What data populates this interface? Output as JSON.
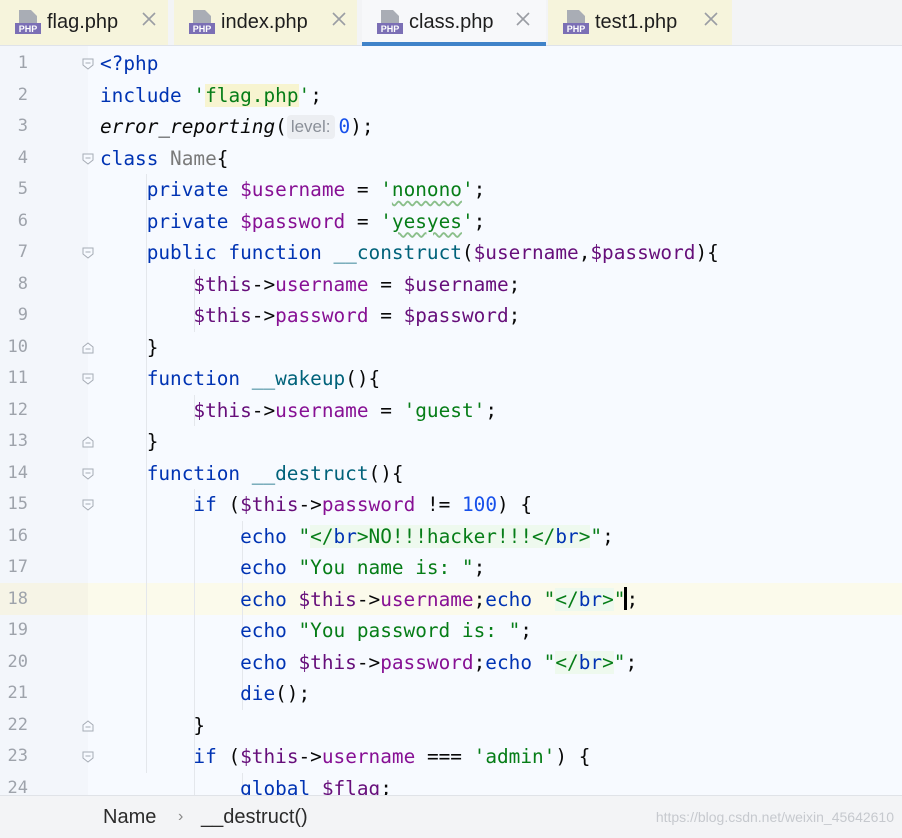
{
  "tabs": [
    {
      "label": "flag.php",
      "icon": "php-file-icon",
      "active": false
    },
    {
      "label": "index.php",
      "icon": "php-file-icon",
      "active": false
    },
    {
      "label": "class.php",
      "icon": "php-file-icon",
      "active": true
    },
    {
      "label": "test1.php",
      "icon": "php-file-icon",
      "active": false
    }
  ],
  "php_icon_text": "PHP",
  "current_line": 18,
  "lines": [
    {
      "n": "1",
      "t": [
        [
          "<?php",
          "kw"
        ]
      ]
    },
    {
      "n": "2",
      "t": [
        [
          "include ",
          "kw"
        ],
        [
          "'",
          "str"
        ],
        [
          "flag.php",
          "strhl"
        ],
        [
          "'",
          "str"
        ],
        [
          ";",
          ""
        ]
      ]
    },
    {
      "n": "3",
      "t": [
        [
          "error_reporting",
          "call"
        ],
        [
          "(",
          ""
        ],
        [
          "level:",
          "hint"
        ],
        [
          "0",
          "num"
        ],
        [
          ");",
          ""
        ]
      ]
    },
    {
      "n": "4",
      "t": [
        [
          "class ",
          "kw"
        ],
        [
          "Name",
          "cls"
        ],
        [
          "{",
          ""
        ]
      ]
    },
    {
      "n": "5",
      "t": [
        [
          "    ",
          ""
        ],
        [
          "private ",
          "kw"
        ],
        [
          "$username",
          "var"
        ],
        [
          " = ",
          ""
        ],
        [
          "'",
          "str"
        ],
        [
          "nonono",
          "strsq"
        ],
        [
          "'",
          "str"
        ],
        [
          ";",
          ""
        ]
      ]
    },
    {
      "n": "6",
      "t": [
        [
          "    ",
          ""
        ],
        [
          "private ",
          "kw"
        ],
        [
          "$password",
          "var"
        ],
        [
          " = ",
          ""
        ],
        [
          "'",
          "str"
        ],
        [
          "yesyes",
          "strsq"
        ],
        [
          "'",
          "str"
        ],
        [
          ";",
          ""
        ]
      ]
    },
    {
      "n": "7",
      "t": [
        [
          "    ",
          ""
        ],
        [
          "public function ",
          "kw"
        ],
        [
          "__construct",
          "fn"
        ],
        [
          "(",
          ""
        ],
        [
          "$username",
          "this"
        ],
        [
          ",",
          ""
        ],
        [
          "$password",
          "this"
        ],
        [
          "){",
          ""
        ]
      ]
    },
    {
      "n": "8",
      "t": [
        [
          "        ",
          ""
        ],
        [
          "$this",
          "this"
        ],
        [
          "->",
          ""
        ],
        [
          "username",
          "var"
        ],
        [
          " = ",
          ""
        ],
        [
          "$username",
          "this"
        ],
        [
          ";",
          ""
        ]
      ]
    },
    {
      "n": "9",
      "t": [
        [
          "        ",
          ""
        ],
        [
          "$this",
          "this"
        ],
        [
          "->",
          ""
        ],
        [
          "password",
          "var"
        ],
        [
          " = ",
          ""
        ],
        [
          "$password",
          "this"
        ],
        [
          ";",
          ""
        ]
      ]
    },
    {
      "n": "10",
      "t": [
        [
          "    }",
          ""
        ]
      ]
    },
    {
      "n": "11",
      "t": [
        [
          "    ",
          ""
        ],
        [
          "function ",
          "kw"
        ],
        [
          "__wakeup",
          "fn"
        ],
        [
          "(){",
          ""
        ]
      ]
    },
    {
      "n": "12",
      "t": [
        [
          "        ",
          ""
        ],
        [
          "$this",
          "this"
        ],
        [
          "->",
          ""
        ],
        [
          "username",
          "var"
        ],
        [
          " = ",
          ""
        ],
        [
          "'guest'",
          "str"
        ],
        [
          ";",
          ""
        ]
      ]
    },
    {
      "n": "13",
      "t": [
        [
          "    }",
          ""
        ]
      ]
    },
    {
      "n": "14",
      "t": [
        [
          "    ",
          ""
        ],
        [
          "function ",
          "kw"
        ],
        [
          "__destruct",
          "fn"
        ],
        [
          "(){",
          ""
        ]
      ]
    },
    {
      "n": "15",
      "t": [
        [
          "        ",
          ""
        ],
        [
          "if ",
          "kw"
        ],
        [
          "(",
          ""
        ],
        [
          "$this",
          "this"
        ],
        [
          "->",
          ""
        ],
        [
          "password",
          "var"
        ],
        [
          " != ",
          ""
        ],
        [
          "100",
          "num"
        ],
        [
          ") {",
          ""
        ]
      ]
    },
    {
      "n": "16",
      "t": [
        [
          "            ",
          ""
        ],
        [
          "echo ",
          "kw"
        ],
        [
          "\"",
          "str"
        ],
        [
          "</",
          "strbg"
        ],
        [
          "br",
          "kwbg"
        ],
        [
          ">NO!!!hacker!!!</",
          "strbg"
        ],
        [
          "br",
          "kwbg"
        ],
        [
          ">",
          "strbg"
        ],
        [
          "\"",
          "str"
        ],
        [
          ";",
          ""
        ]
      ]
    },
    {
      "n": "17",
      "t": [
        [
          "            ",
          ""
        ],
        [
          "echo ",
          "kw"
        ],
        [
          "\"You name is: \"",
          "str"
        ],
        [
          ";",
          ""
        ]
      ]
    },
    {
      "n": "18",
      "t": [
        [
          "            ",
          ""
        ],
        [
          "echo ",
          "kw"
        ],
        [
          "$this",
          "this"
        ],
        [
          "->",
          ""
        ],
        [
          "username",
          "var"
        ],
        [
          ";",
          ""
        ],
        [
          "echo ",
          "kw"
        ],
        [
          "\"",
          "str"
        ],
        [
          "</",
          "strbg"
        ],
        [
          "br",
          "kwbg"
        ],
        [
          ">",
          "strbg"
        ],
        [
          "\"",
          "str"
        ],
        [
          "|",
          "caret"
        ],
        [
          ";",
          ""
        ]
      ]
    },
    {
      "n": "19",
      "t": [
        [
          "            ",
          ""
        ],
        [
          "echo ",
          "kw"
        ],
        [
          "\"You password is: \"",
          "str"
        ],
        [
          ";",
          ""
        ]
      ]
    },
    {
      "n": "20",
      "t": [
        [
          "            ",
          ""
        ],
        [
          "echo ",
          "kw"
        ],
        [
          "$this",
          "this"
        ],
        [
          "->",
          ""
        ],
        [
          "password",
          "var"
        ],
        [
          ";",
          ""
        ],
        [
          "echo ",
          "kw"
        ],
        [
          "\"",
          "str"
        ],
        [
          "</",
          "strbg"
        ],
        [
          "br",
          "kwbg"
        ],
        [
          ">",
          "strbg"
        ],
        [
          "\"",
          "str"
        ],
        [
          ";",
          ""
        ]
      ]
    },
    {
      "n": "21",
      "t": [
        [
          "            ",
          ""
        ],
        [
          "die",
          "kw"
        ],
        [
          "();",
          ""
        ]
      ]
    },
    {
      "n": "22",
      "t": [
        [
          "        }",
          ""
        ]
      ]
    },
    {
      "n": "23",
      "t": [
        [
          "        ",
          ""
        ],
        [
          "if ",
          "kw"
        ],
        [
          "(",
          ""
        ],
        [
          "$this",
          "this"
        ],
        [
          "->",
          ""
        ],
        [
          "username",
          "var"
        ],
        [
          " === ",
          ""
        ],
        [
          "'admin'",
          "str"
        ],
        [
          ") {",
          ""
        ]
      ]
    },
    {
      "n": "24",
      "t": [
        [
          "            ",
          ""
        ],
        [
          "global ",
          "kw"
        ],
        [
          "$flag",
          "this"
        ],
        [
          ";",
          ""
        ]
      ]
    }
  ],
  "breadcrumb": {
    "items": [
      "Name",
      "__destruct()"
    ],
    "separator": "›"
  },
  "watermark": "https://blog.csdn.net/weixin_45642610",
  "colors": {
    "keyword": "#0033b3",
    "variable": "#871094",
    "string": "#067d17",
    "number": "#1750eb",
    "tab_active_underline": "#4083c9"
  }
}
